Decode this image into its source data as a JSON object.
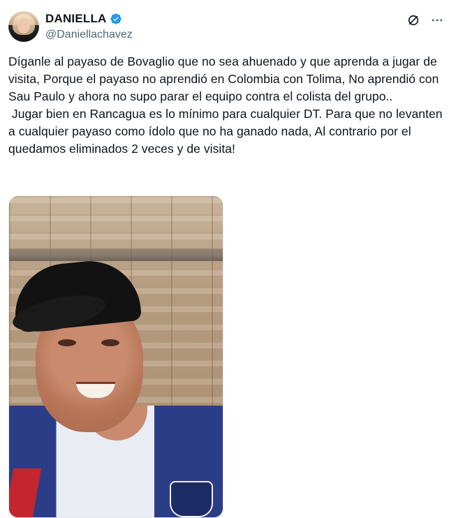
{
  "author": {
    "display_name": "DANIELLA",
    "handle": "@Daniellachavez",
    "verified": true,
    "verified_color": "#1d9bf0"
  },
  "actions": {
    "grok_icon": "slash-circle-icon",
    "more_icon": "more-horizontal-icon"
  },
  "tweet": {
    "text": "Díganle al payaso de Bovaglio que no sea ahuenado y que aprenda a jugar de visita, Porque el payaso no aprendió en Colombia con Tolima, No aprendió con Sau Paulo y ahora no supo parar el equipo contra el colista del grupo..\n Jugar bien en Rancagua es lo mínimo para cualquier DT. Para que no levanten a cualquier payaso como ídolo que no ha ganado nada, Al contrario por el quedamos eliminados 2 veces y de visita!"
  },
  "media": {
    "type": "photo",
    "subject": "smiling man in black cap"
  }
}
